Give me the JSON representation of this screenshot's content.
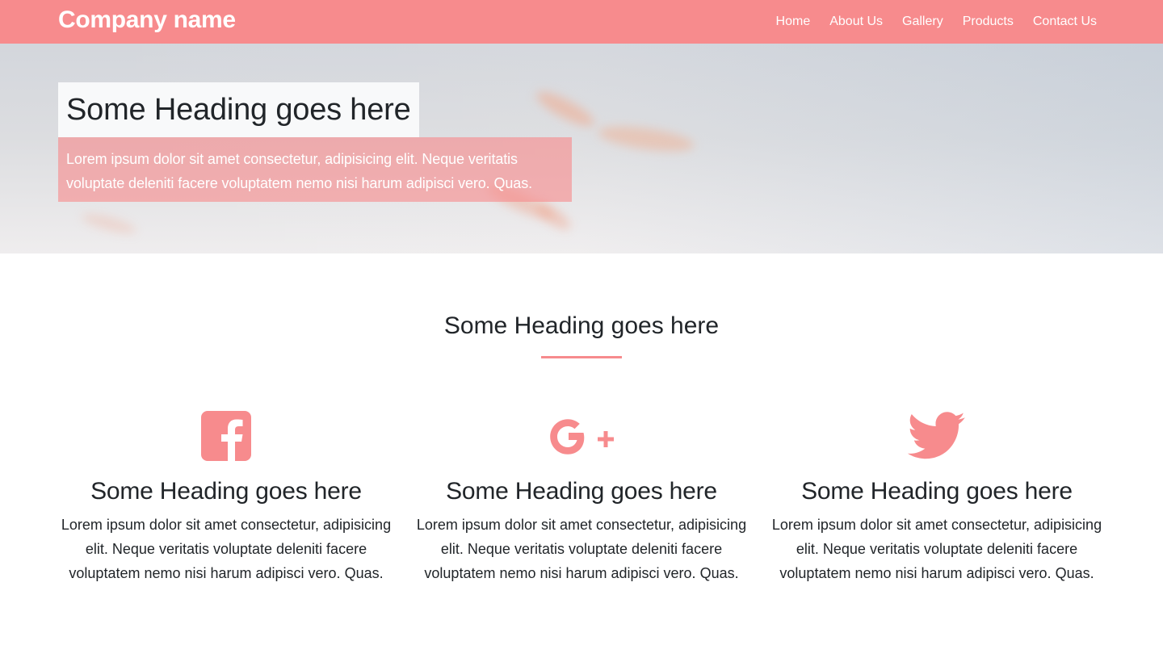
{
  "navbar": {
    "brand": "Company name",
    "links": [
      "Home",
      "About Us",
      "Gallery",
      "Products",
      "Contact Us"
    ]
  },
  "hero": {
    "title": "Some Heading goes here",
    "text": "Lorem ipsum dolor sit amet consectetur, adipisicing elit. Neque veritatis voluptate deleniti facere voluptatem nemo nisi harum adipisci vero. Quas."
  },
  "section": {
    "title": "Some Heading goes here"
  },
  "features": [
    {
      "icon": "facebook-icon",
      "title": "Some Heading goes here",
      "text": "Lorem ipsum dolor sit amet consectetur, adipisicing elit. Neque veritatis voluptate deleniti facere voluptatem nemo nisi harum adipisci vero. Quas."
    },
    {
      "icon": "google-plus-icon",
      "title": "Some Heading goes here",
      "text": "Lorem ipsum dolor sit amet consectetur, adipisicing elit. Neque veritatis voluptate deleniti facere voluptatem nemo nisi harum adipisci vero. Quas."
    },
    {
      "icon": "twitter-icon",
      "title": "Some Heading goes here",
      "text": "Lorem ipsum dolor sit amet consectetur, adipisicing elit. Neque veritatis voluptate deleniti facere voluptatem nemo nisi harum adipisci vero. Quas."
    }
  ],
  "colors": {
    "accent": "#f78b8d",
    "text": "#212529",
    "hero_title_bg": "#f8f9fa"
  }
}
